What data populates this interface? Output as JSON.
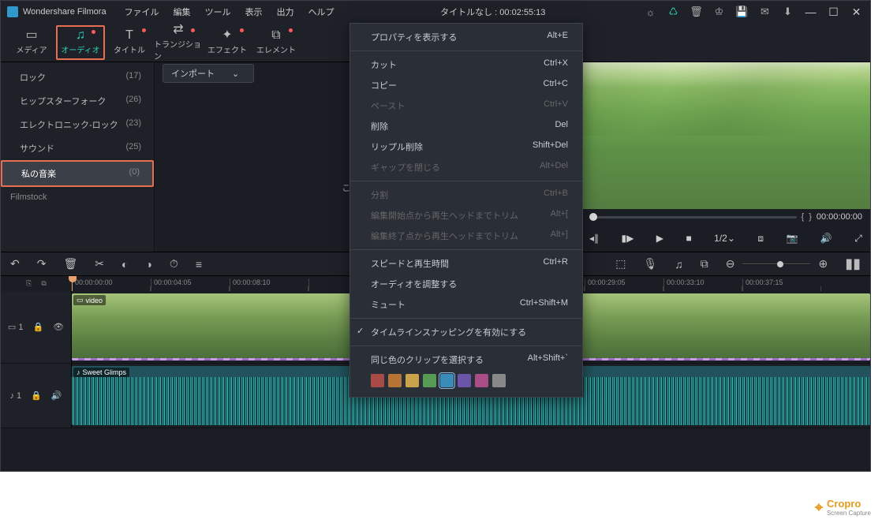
{
  "titlebar": {
    "brand": "Wondershare Filmora",
    "menus": [
      "ファイル",
      "編集",
      "ツール",
      "表示",
      "出力",
      "ヘルプ"
    ],
    "project": "タイトルなし",
    "duration": "00:02:55:13"
  },
  "toolbar": {
    "tabs": [
      {
        "label": "メディア",
        "glyph": "▭"
      },
      {
        "label": "オーディオ",
        "glyph": "♫",
        "active": true,
        "dot": true
      },
      {
        "label": "タイトル",
        "glyph": "T",
        "dot": true
      },
      {
        "label": "トランジション",
        "glyph": "⇄",
        "dot": true
      },
      {
        "label": "エフェクト",
        "glyph": "✦",
        "dot": true
      },
      {
        "label": "エレメント",
        "glyph": "⧉",
        "dot": true
      }
    ]
  },
  "sidebar": {
    "items": [
      {
        "label": "ロック",
        "count": "(17)"
      },
      {
        "label": "ヒップスターフォーク",
        "count": "(26)"
      },
      {
        "label": "エレクトロニック-ロック",
        "count": "(23)"
      },
      {
        "label": "サウンド",
        "count": "(25)"
      },
      {
        "label": "私の音楽",
        "count": "(0)",
        "sel": true
      }
    ],
    "foot": "Filmstock"
  },
  "center": {
    "import_btn": "インポート",
    "import_caret": "⌄",
    "placeholder": "ここにメディ"
  },
  "preview": {
    "marks": {
      "l": "{",
      "r": "}"
    },
    "time": "00:00:00:00",
    "ratio": "1/2",
    "ratio_caret": "⌄"
  },
  "editbar": {
    "icons": [
      "↶",
      "↷",
      "🗑",
      "✂",
      "◐",
      "◑",
      "⏱",
      "≡"
    ],
    "right": [
      "⬚",
      "🎙",
      "♫",
      "⧉"
    ]
  },
  "ruler": {
    "head_icons": [
      "⎘",
      "⧉"
    ],
    "times": [
      "00:00:00:00",
      "00:00:04:05",
      "00:00:08:10",
      "00:00:29:05",
      "00:00:33:10",
      "00:00:37:15"
    ]
  },
  "tracks": {
    "video": {
      "head": "▭ 1",
      "lock": "🔒",
      "eye": "👁",
      "clip_label": "video",
      "clip_icon": "▭"
    },
    "audio": {
      "head": "♪ 1",
      "lock": "🔒",
      "vol": "🔊",
      "clip_label": "Sweet Glimps",
      "clip_icon": "♪"
    }
  },
  "ctx": {
    "rows": [
      {
        "t": "プロパティを表示する",
        "s": "Alt+E"
      },
      {
        "sep": true
      },
      {
        "t": "カット",
        "s": "Ctrl+X"
      },
      {
        "t": "コピー",
        "s": "Ctrl+C"
      },
      {
        "t": "ペースト",
        "s": "Ctrl+V",
        "dis": true
      },
      {
        "t": "削除",
        "s": "Del"
      },
      {
        "t": "リップル削除",
        "s": "Shift+Del"
      },
      {
        "t": "ギャップを閉じる",
        "s": "Alt+Del",
        "dis": true
      },
      {
        "sep": true
      },
      {
        "t": "分割",
        "s": "Ctrl+B",
        "dis": true
      },
      {
        "t": "編集開始点から再生ヘッドまでトリム",
        "s": "Alt+[",
        "dis": true
      },
      {
        "t": "編集終了点から再生ヘッドまでトリム",
        "s": "Alt+]",
        "dis": true
      },
      {
        "sep": true
      },
      {
        "t": "スピードと再生時間",
        "s": "Ctrl+R"
      },
      {
        "t": "オーディオを調整する",
        "s": ""
      },
      {
        "t": "ミュート",
        "s": "Ctrl+Shift+M"
      },
      {
        "sep": true
      },
      {
        "t": "タイムラインスナッピングを有効にする",
        "s": "",
        "chk": true
      },
      {
        "sep": true
      },
      {
        "t": "同じ色のクリップを選択する",
        "s": "Alt+Shift+`"
      }
    ],
    "colors": [
      "#a84a46",
      "#b57436",
      "#c9a24a",
      "#569a56",
      "#3b8bb9",
      "#6a55a8",
      "#a84d86",
      "#888888"
    ],
    "sel_color": 4
  },
  "watermark": {
    "name": "Cropro",
    "sub": "Screen Capture",
    "glyph": "⌖"
  }
}
